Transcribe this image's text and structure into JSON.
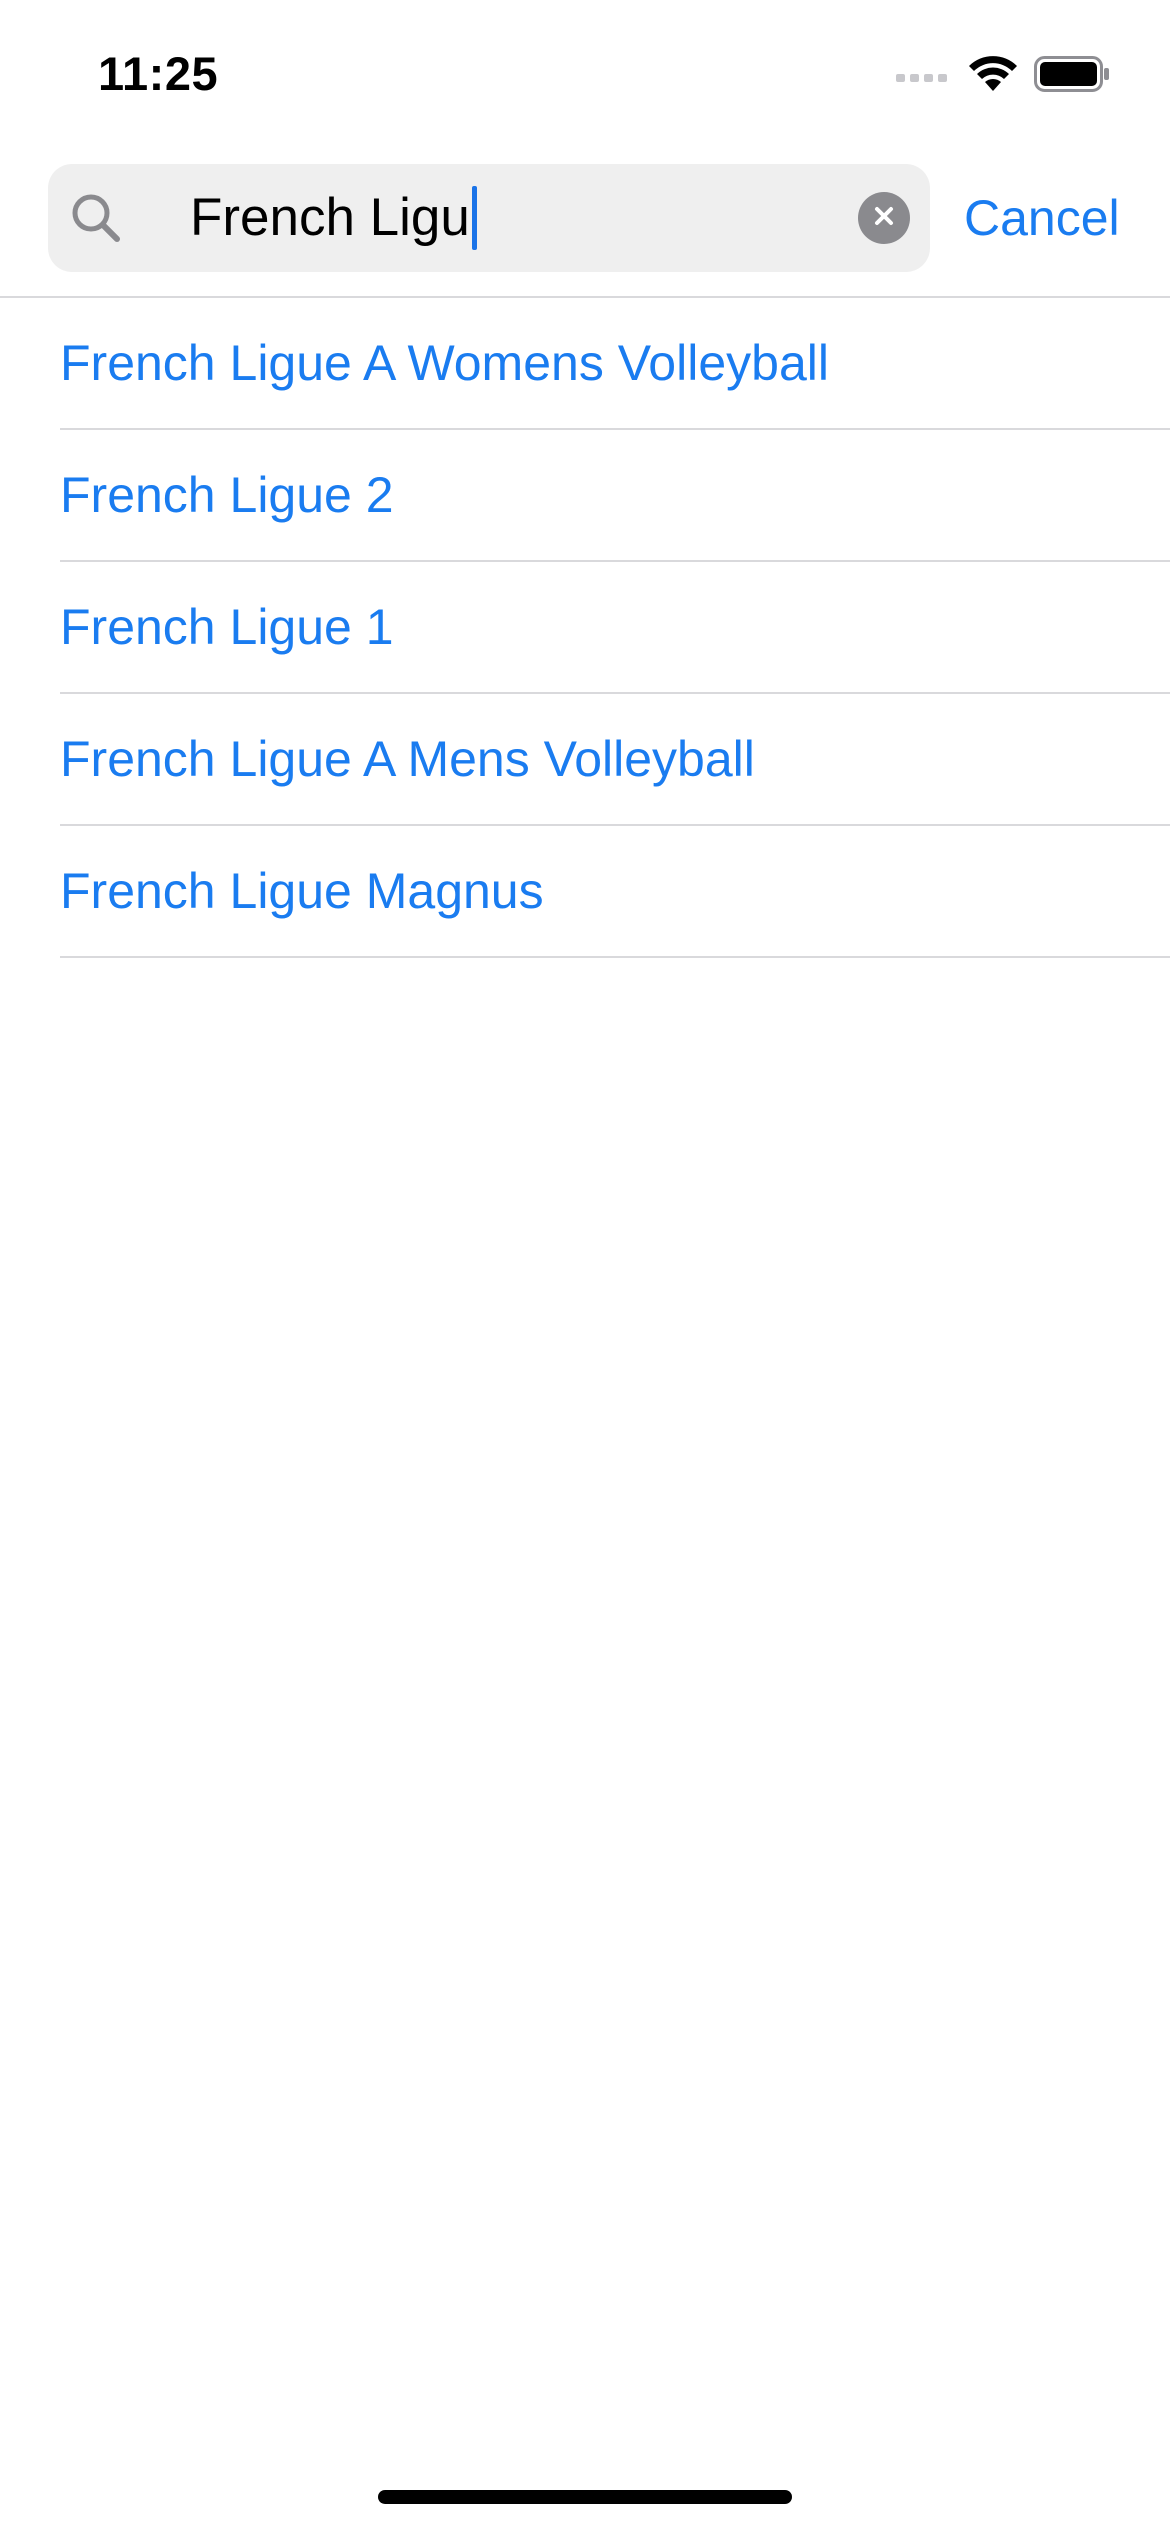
{
  "status_bar": {
    "time": "11:25",
    "icons": [
      "cellular-signal-icon",
      "wifi-icon",
      "battery-icon"
    ]
  },
  "search": {
    "value": "French Ligu",
    "placeholder": "",
    "icon": "search-icon",
    "clear_icon": "clear-icon",
    "cancel_label": "Cancel"
  },
  "results": [
    {
      "label": "French Ligue A Womens Volleyball"
    },
    {
      "label": "French Ligue 2"
    },
    {
      "label": "French Ligue 1"
    },
    {
      "label": "French Ligue A Mens Volleyball"
    },
    {
      "label": "French Ligue Magnus"
    }
  ],
  "colors": {
    "accent": "#1a7cf0",
    "search_field_bg": "#efefef",
    "separator": "#d9d9dc",
    "clear_button": "#8a8a8e"
  }
}
